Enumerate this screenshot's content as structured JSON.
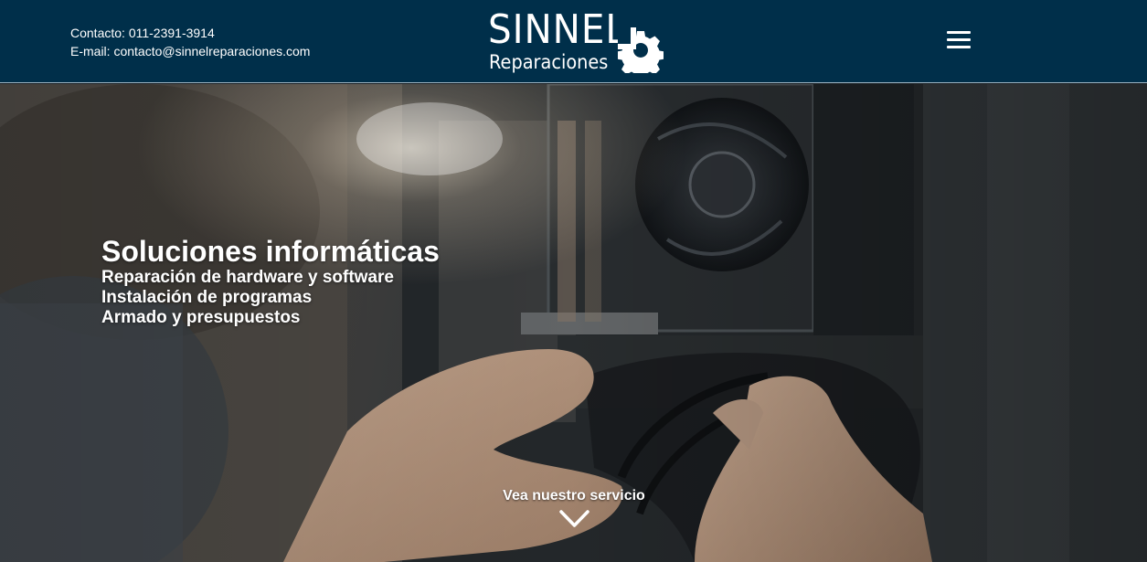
{
  "header": {
    "contact_phone": "Contacto: 011-2391-3914",
    "contact_email": "E-mail: contacto@sinnelreparaciones.com",
    "logo_main": "SINNEL",
    "logo_sub": "Reparaciones",
    "menu_icon": "hamburger-menu-icon"
  },
  "hero": {
    "headline": "Soluciones informáticas",
    "lines": [
      "Reparación de hardware y software",
      "Instalación de programas",
      "Armado y presupuestos"
    ],
    "cta_label": "Vea nuestro servicio",
    "cta_icon": "chevron-down-icon"
  },
  "colors": {
    "header_bg": "#002f4a",
    "text": "#ffffff"
  }
}
